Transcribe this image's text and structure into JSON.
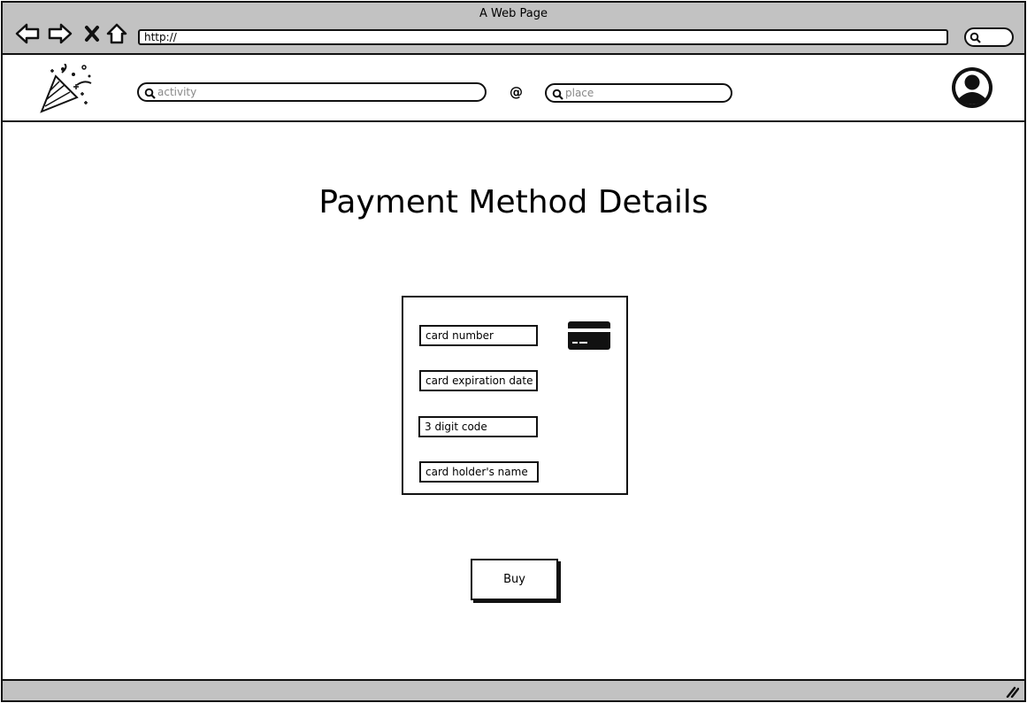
{
  "window": {
    "title": "A Web Page"
  },
  "browser": {
    "url": "http://",
    "icons": [
      "back-arrow-icon",
      "forward-arrow-icon",
      "stop-icon",
      "home-icon",
      "search-icon"
    ]
  },
  "header": {
    "activity_placeholder": "activity",
    "at_symbol": "@",
    "place_placeholder": "place",
    "logo_icon": "party-popper-icon",
    "avatar_icon": "user-avatar-icon"
  },
  "page": {
    "title": "Payment Method Details",
    "fields": {
      "card_number": "card number",
      "expiration": "card expiration date",
      "code": "3 digit code",
      "holder": "card holder's name"
    },
    "card_icon": "credit-card-icon",
    "buy_label": "Buy"
  },
  "colors": {
    "chrome": "#c2c2c2",
    "ink": "#111111",
    "placeholder": "#888888"
  }
}
